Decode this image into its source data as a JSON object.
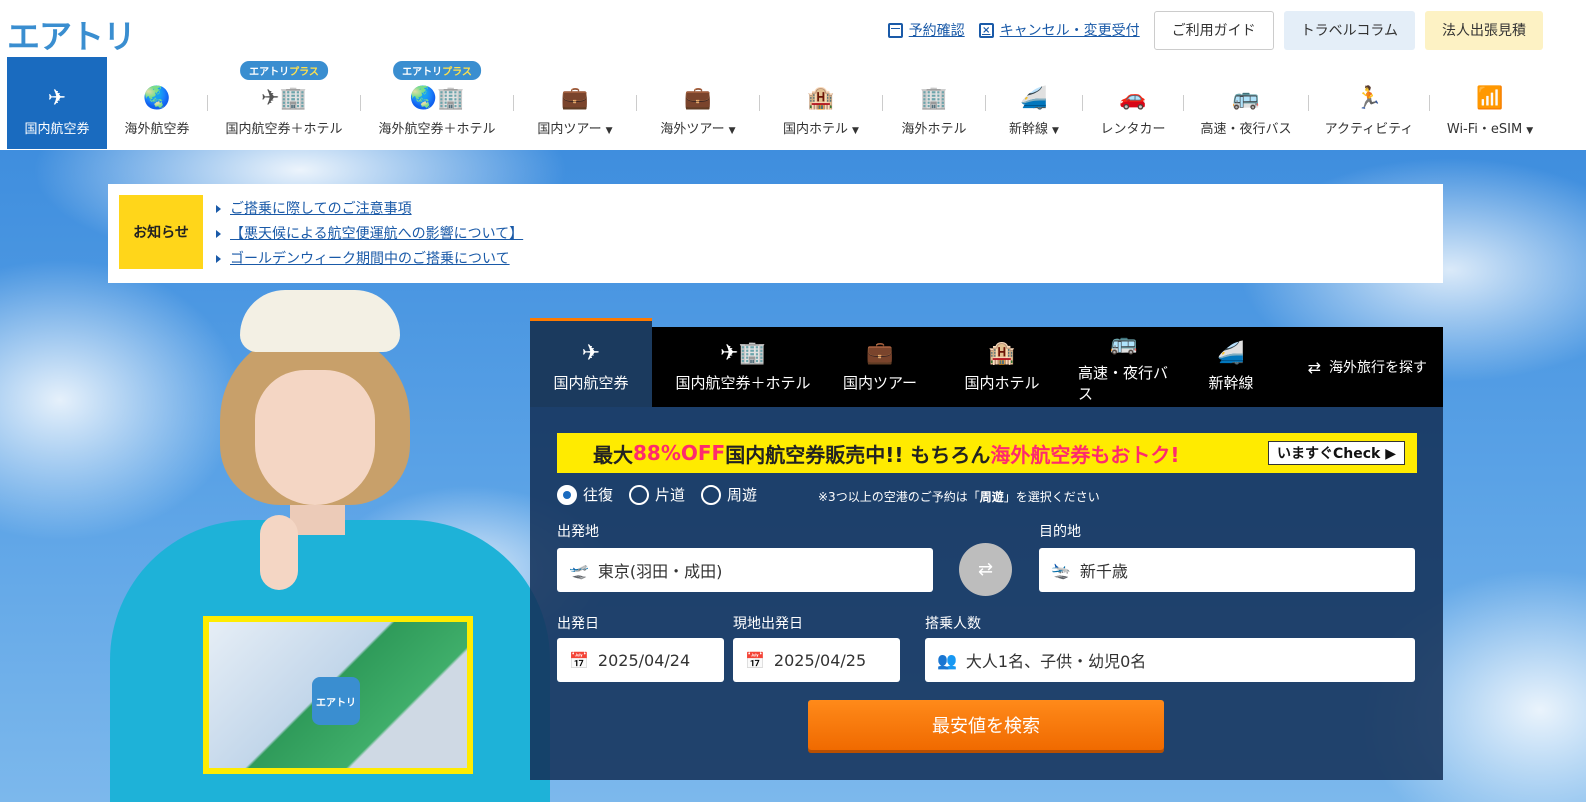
{
  "header": {
    "logo": "エアトリ",
    "links": {
      "booking_check": "予約確認",
      "cancel_change": "キャンセル・変更受付"
    },
    "buttons": {
      "guide": "ご利用ガイド",
      "travel_column": "トラベルコラム",
      "corporate": "法人出張見積"
    }
  },
  "nav": {
    "badge_prefix": "エアトリ",
    "badge_suffix": "プラス",
    "items": [
      {
        "label": "国内航空券",
        "icon": "airplane-icon",
        "glyph": "✈"
      },
      {
        "label": "海外航空券",
        "icon": "globe-plane-icon",
        "glyph": "🌏"
      },
      {
        "label": "国内航空券＋ホテル",
        "icon": "plane-hotel-icon",
        "glyph": "✈🏢"
      },
      {
        "label": "海外航空券＋ホテル",
        "icon": "globe-hotel-icon",
        "glyph": "🌏🏢"
      },
      {
        "label": "国内ツアー",
        "icon": "suitcase-icon",
        "glyph": "💼"
      },
      {
        "label": "海外ツアー",
        "icon": "suitcase-globe-icon",
        "glyph": "💼"
      },
      {
        "label": "国内ホテル",
        "icon": "hotel-icon",
        "glyph": "🏨"
      },
      {
        "label": "海外ホテル",
        "icon": "building-icon",
        "glyph": "🏢"
      },
      {
        "label": "新幹線",
        "icon": "bullet-train-icon",
        "glyph": "🚄"
      },
      {
        "label": "レンタカー",
        "icon": "car-icon",
        "glyph": "🚗"
      },
      {
        "label": "高速・夜行バス",
        "icon": "bus-icon",
        "glyph": "🚌"
      },
      {
        "label": "アクティビティ",
        "icon": "running-person-icon",
        "glyph": "🏃"
      },
      {
        "label": "Wi-Fi・eSIM",
        "icon": "wifi-icon",
        "glyph": "📶"
      }
    ]
  },
  "notice": {
    "label": "お知らせ",
    "items": [
      "ご搭乗に際してのご注意事項",
      "【悪天候による航空便運航への影響について】",
      "ゴールデンウィーク期間中のご搭乗について"
    ]
  },
  "promo_image": {
    "logo_text": "エアトリ"
  },
  "search": {
    "tabs": [
      {
        "label": "国内航空券",
        "glyph": "✈"
      },
      {
        "label": "国内航空券＋ホテル",
        "glyph": "✈🏢"
      },
      {
        "label": "国内ツアー",
        "glyph": "💼"
      },
      {
        "label": "国内ホテル",
        "glyph": "🏨"
      },
      {
        "label": "高速・夜行バス",
        "glyph": "🚌"
      },
      {
        "label": "新幹線",
        "glyph": "🚄"
      }
    ],
    "overseas_link": "海外旅行を探す",
    "banner": {
      "part1": "最大",
      "part2": "88%OFF",
      "part3": " 国内航空券販売中!! もちろん",
      "part4": "海外航空券もおトク!",
      "cta": "いますぐCheck ▶"
    },
    "trip_types": [
      "往復",
      "片道",
      "周遊"
    ],
    "trip_note_pre": "※3つ以上の空港のご予約は「",
    "trip_note_bold": "周遊",
    "trip_note_post": "」を選択ください",
    "from_label": "出発地",
    "from_value": "東京(羽田・成田)",
    "to_label": "目的地",
    "to_value": "新千歳",
    "depart_label": "出発日",
    "depart_value": "2025/04/24",
    "return_label": "現地出発日",
    "return_value": "2025/04/25",
    "passengers_label": "搭乗人数",
    "passengers_value": "大人1名、子供・幼児0名",
    "submit": "最安値を検索"
  },
  "colors": {
    "brand_blue": "#1a6bbf",
    "accent_orange": "#ff7a00",
    "banner_yellow": "#ffeb00",
    "notice_yellow": "#ffd61a"
  }
}
